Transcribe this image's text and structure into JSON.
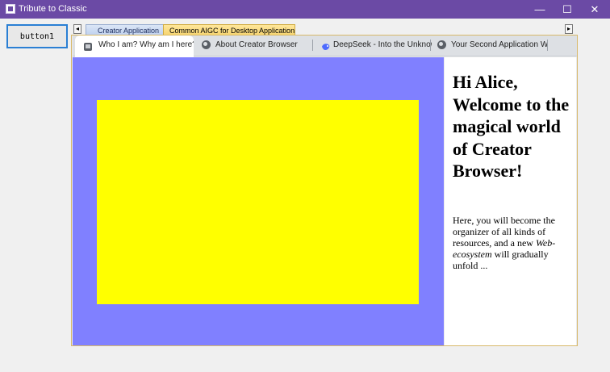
{
  "window": {
    "title": "Tribute to Classic",
    "controls": {
      "minimize": "—",
      "maximize": "☐",
      "close": "✕"
    }
  },
  "left_button": {
    "label": "button1"
  },
  "outer_tabs": {
    "scroll_left": "◂",
    "scroll_right": "▸",
    "items": [
      {
        "label": "Creator Application"
      },
      {
        "label": "Common AIGC for Desktop Application"
      }
    ]
  },
  "browser_tabs": [
    {
      "label": "Who I am? Why am I here?",
      "icon": "page-icon",
      "active": true
    },
    {
      "label": "About Creator Browser",
      "icon": "globe-icon"
    },
    {
      "label": "DeepSeek - Into the Unknow",
      "icon": "deepseek-icon"
    },
    {
      "label": "Your Second Application We",
      "icon": "globe-icon"
    }
  ],
  "page": {
    "heading": "Hi Alice, Welcome to the magical world of Creator Browser!",
    "text_before": "Here, you will become the organizer of all kinds of resources, and a new ",
    "text_em": "Web-ecosystem",
    "text_after": " will gradually unfold ...",
    "colors": {
      "left_panel": "#8080ff",
      "box": "#ffff00"
    }
  }
}
